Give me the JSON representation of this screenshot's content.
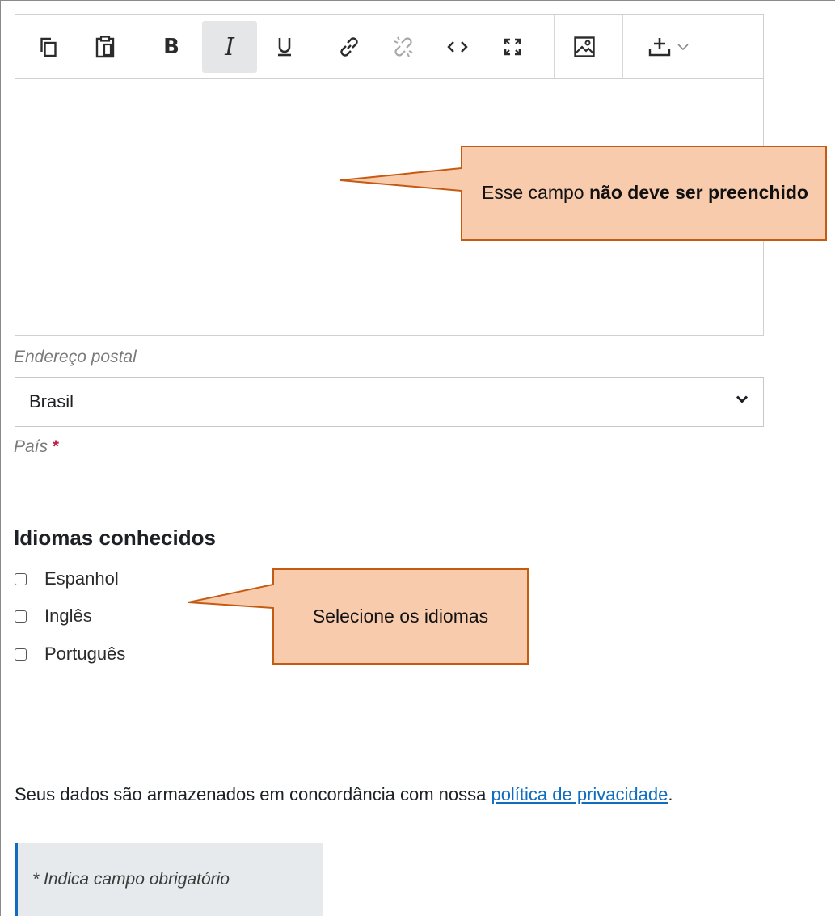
{
  "editor": {
    "toolbar": {
      "copy_icon": "copy-icon",
      "paste_icon": "paste-icon",
      "bold_label": "B",
      "italic_label": "I",
      "underline_icon": "underline-icon",
      "link_icon": "link-icon",
      "unlink_icon": "unlink-icon",
      "code_icon": "code-icon",
      "fullscreen_icon": "fullscreen-icon",
      "image_icon": "image-icon",
      "more_icon": "add-more-icon"
    },
    "content": "",
    "callout": {
      "text_before": "Esse campo ",
      "text_bold": "não deve ser preenchido"
    }
  },
  "address_label": "Endereço postal",
  "country": {
    "selected": "Brasil",
    "label": "País",
    "required_marker": "*"
  },
  "languages": {
    "title": "Idiomas conhecidos",
    "options": [
      "Espanhol",
      "Inglês",
      "Português"
    ],
    "callout": "Selecione os idiomas"
  },
  "privacy": {
    "text": "Seus dados são armazenados em concordância com nossa ",
    "link": "política de privacidade",
    "suffix": "."
  },
  "required_note": "* Indica campo obrigatório",
  "colors": {
    "callout_fill": "#f8cbad",
    "callout_border": "#c55a11",
    "link": "#0f6cbf",
    "required": "#c41c4b"
  }
}
